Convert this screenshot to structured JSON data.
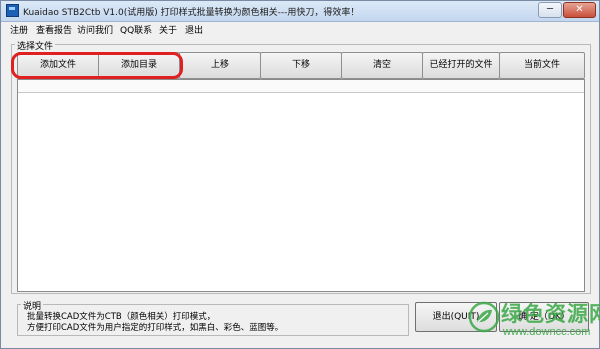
{
  "window": {
    "title": "Kuaidao STB2Ctb  V1.0(试用版) 打印样式批量转换为颜色相关---用快刀，得效率！",
    "minimize_glyph": "─",
    "close_glyph": "✕"
  },
  "menu": [
    "注册",
    "查看报告",
    "访问我们",
    "QQ联系",
    "关于",
    "退出"
  ],
  "file_group": {
    "label": "选择文件",
    "buttons": [
      "添加文件",
      "添加目录",
      "上移",
      "下移",
      "清空",
      "已经打开的文件",
      "当前文件"
    ]
  },
  "description": {
    "label": "说明",
    "line1": "批量转换CAD文件为CTB（颜色相关）打印模式，",
    "line2": "方便打印CAD文件为用户指定的打印样式，如黑白、彩色、蓝图等。"
  },
  "actions": {
    "exit": "退出(QUIT)",
    "ok": "确    定（OK）"
  },
  "watermark": {
    "title": "绿色资源网",
    "url": "www.downcc.com",
    "color": "#3aa845"
  },
  "colors": {
    "highlight": "#e02020"
  }
}
